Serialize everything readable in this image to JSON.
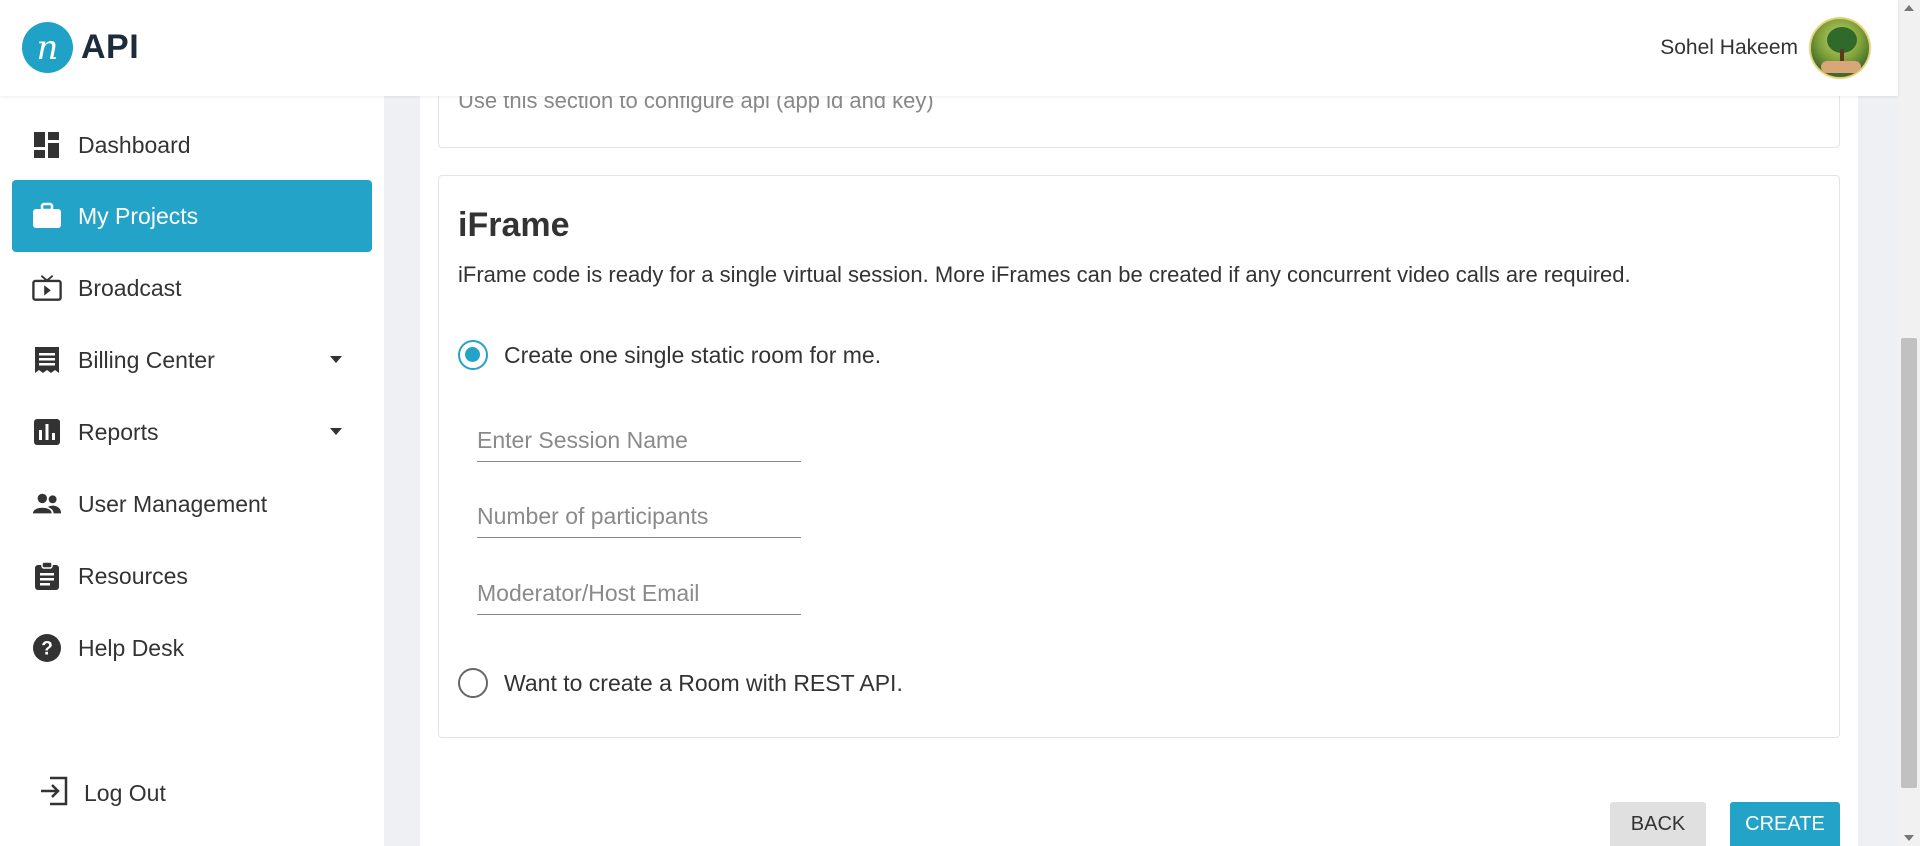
{
  "header": {
    "logo_glyph": "n",
    "logo_text": "API",
    "user_name": "Sohel Hakeem"
  },
  "sidebar": {
    "items": [
      {
        "label": "Dashboard",
        "icon": "dashboard-icon",
        "active": false
      },
      {
        "label": "My Projects",
        "icon": "briefcase-icon",
        "active": true
      },
      {
        "label": "Broadcast",
        "icon": "tv-play-icon",
        "active": false
      },
      {
        "label": "Billing Center",
        "icon": "receipt-icon",
        "active": false,
        "has_dropdown": true
      },
      {
        "label": "Reports",
        "icon": "bar-chart-icon",
        "active": false,
        "has_dropdown": true
      },
      {
        "label": "User Management",
        "icon": "people-icon",
        "active": false
      },
      {
        "label": "Resources",
        "icon": "clipboard-icon",
        "active": false
      },
      {
        "label": "Help Desk",
        "icon": "help-circle-icon",
        "active": false
      }
    ],
    "logout_label": "Log Out"
  },
  "api_card": {
    "description": "Use this section to configure api (app id and key)"
  },
  "iframe_card": {
    "title": "iFrame",
    "description": "iFrame code is ready for a single virtual session. More iFrames can be created if any concurrent video calls are required.",
    "option_static_label": "Create one single static room for me.",
    "option_static_checked": true,
    "session_name_placeholder": "Enter Session Name",
    "participants_placeholder": "Number of participants",
    "email_placeholder": "Moderator/Host Email",
    "option_rest_label": "Want to create a Room with REST API.",
    "option_rest_checked": false
  },
  "actions": {
    "back_label": "BACK",
    "create_label": "CREATE"
  },
  "colors": {
    "accent": "#24a3c9",
    "green": "#1e9a54"
  }
}
